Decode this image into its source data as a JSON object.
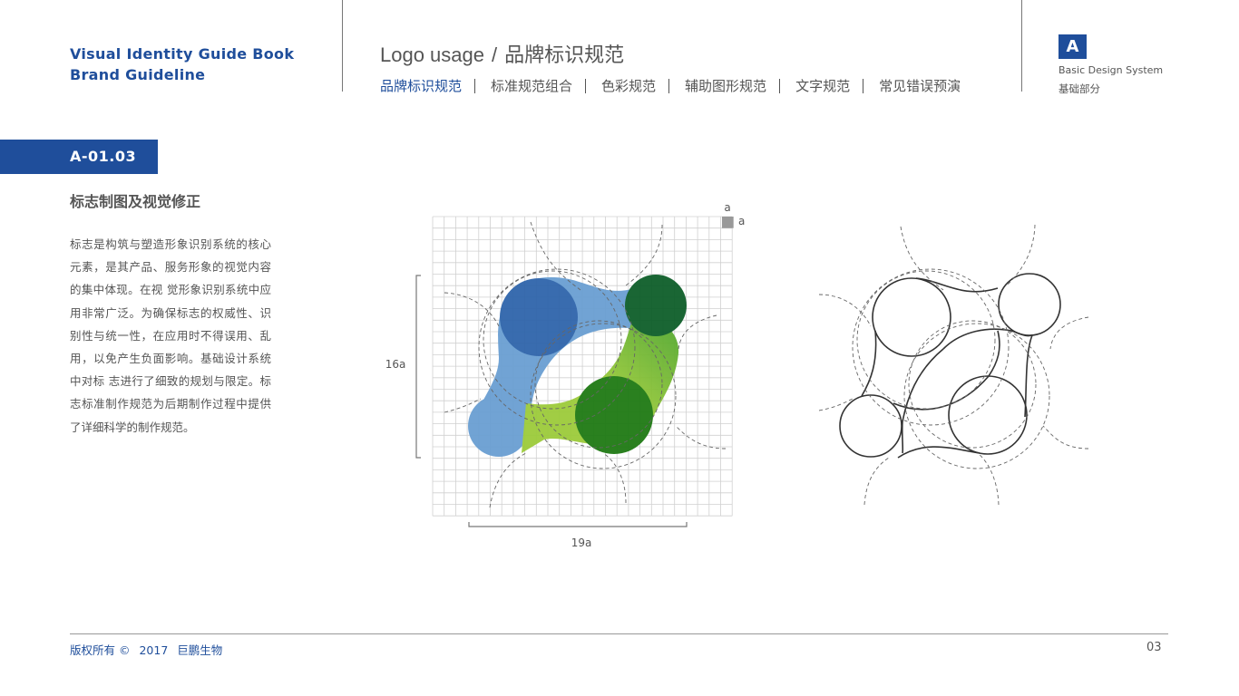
{
  "header": {
    "brand_line1": "Visual Identity Guide Book",
    "brand_line2": "Brand Guideline",
    "heading_en": "Logo usage",
    "heading_sep": "/",
    "heading_cn": "品牌标识规范",
    "nav": [
      {
        "label": "品牌标识规范",
        "active": true
      },
      {
        "label": "标准规范组合",
        "active": false
      },
      {
        "label": "色彩规范",
        "active": false
      },
      {
        "label": "辅助图形规范",
        "active": false
      },
      {
        "label": "文字规范",
        "active": false
      },
      {
        "label": "常见错误预演",
        "active": false
      }
    ],
    "section_letter": "A",
    "section_en": "Basic Design System",
    "section_cn": "基础部分"
  },
  "content": {
    "code": "A-01.03",
    "title": "标志制图及视觉修正",
    "description": "标志是构筑与塑造形象识别系统的核心元素，是其产品、服务形象的视觉内容的集中体现。在视 觉形象识别系统中应用非常广泛。为确保标志的权威性、识别性与统一性，在应用时不得误用、乱用，以免产生负面影响。基础设计系统中对标 志进行了细致的规划与限定。标志标准制作规范为后期制作过程中提供了详细科学的制作规范。"
  },
  "figure": {
    "unit_label_top": "a",
    "unit_label_side": "a",
    "height_label": "16a",
    "width_label": "19a",
    "colors": {
      "blue_dark": "#2f65ab",
      "blue_light": "#6a9fd2",
      "green_dark": "#0e5e2a",
      "green_mid": "#1f7a14",
      "green_light": "#8cc43c",
      "grid": "#d0d0d0",
      "unit_square": "#999999"
    }
  },
  "footer": {
    "copyright": "版权所有 ©",
    "year": "2017",
    "company": "巨鹏生物",
    "page": "03"
  }
}
